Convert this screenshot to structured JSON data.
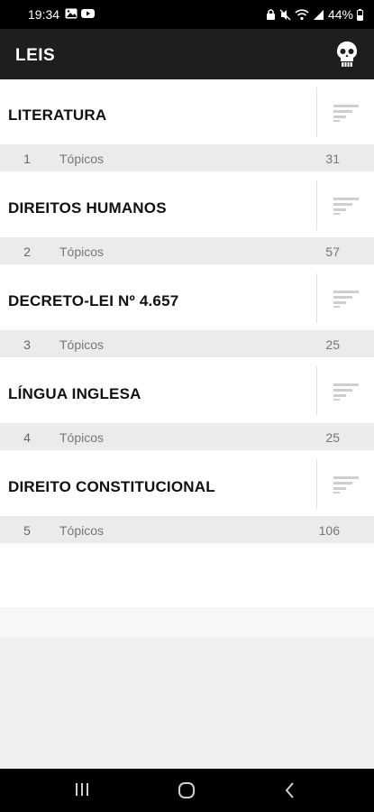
{
  "status_bar": {
    "time": "19:34",
    "battery": "44%",
    "icons": [
      "gallery-icon",
      "youtube-icon",
      "lock-icon",
      "mute-icon",
      "wifi-icon",
      "signal-icon",
      "battery-icon"
    ]
  },
  "app_bar": {
    "title": "LEIS",
    "icon": "skull-icon"
  },
  "list": {
    "items": [
      {
        "title": "LITERATURA",
        "number": "1",
        "label": "Tópicos",
        "count": "31"
      },
      {
        "title": "DIREITOS HUMANOS",
        "number": "2",
        "label": "Tópicos",
        "count": "57"
      },
      {
        "title": "DECRETO-LEI Nº 4.657",
        "number": "3",
        "label": "Tópicos",
        "count": "25"
      },
      {
        "title": "LÍNGUA INGLESA",
        "number": "4",
        "label": "Tópicos",
        "count": "25"
      },
      {
        "title": "DIREITO CONSTITUCIONAL",
        "number": "5",
        "label": "Tópicos",
        "count": "106"
      }
    ]
  },
  "nav_bar": {
    "buttons": [
      "recent-apps-icon",
      "home-icon",
      "back-icon"
    ]
  }
}
